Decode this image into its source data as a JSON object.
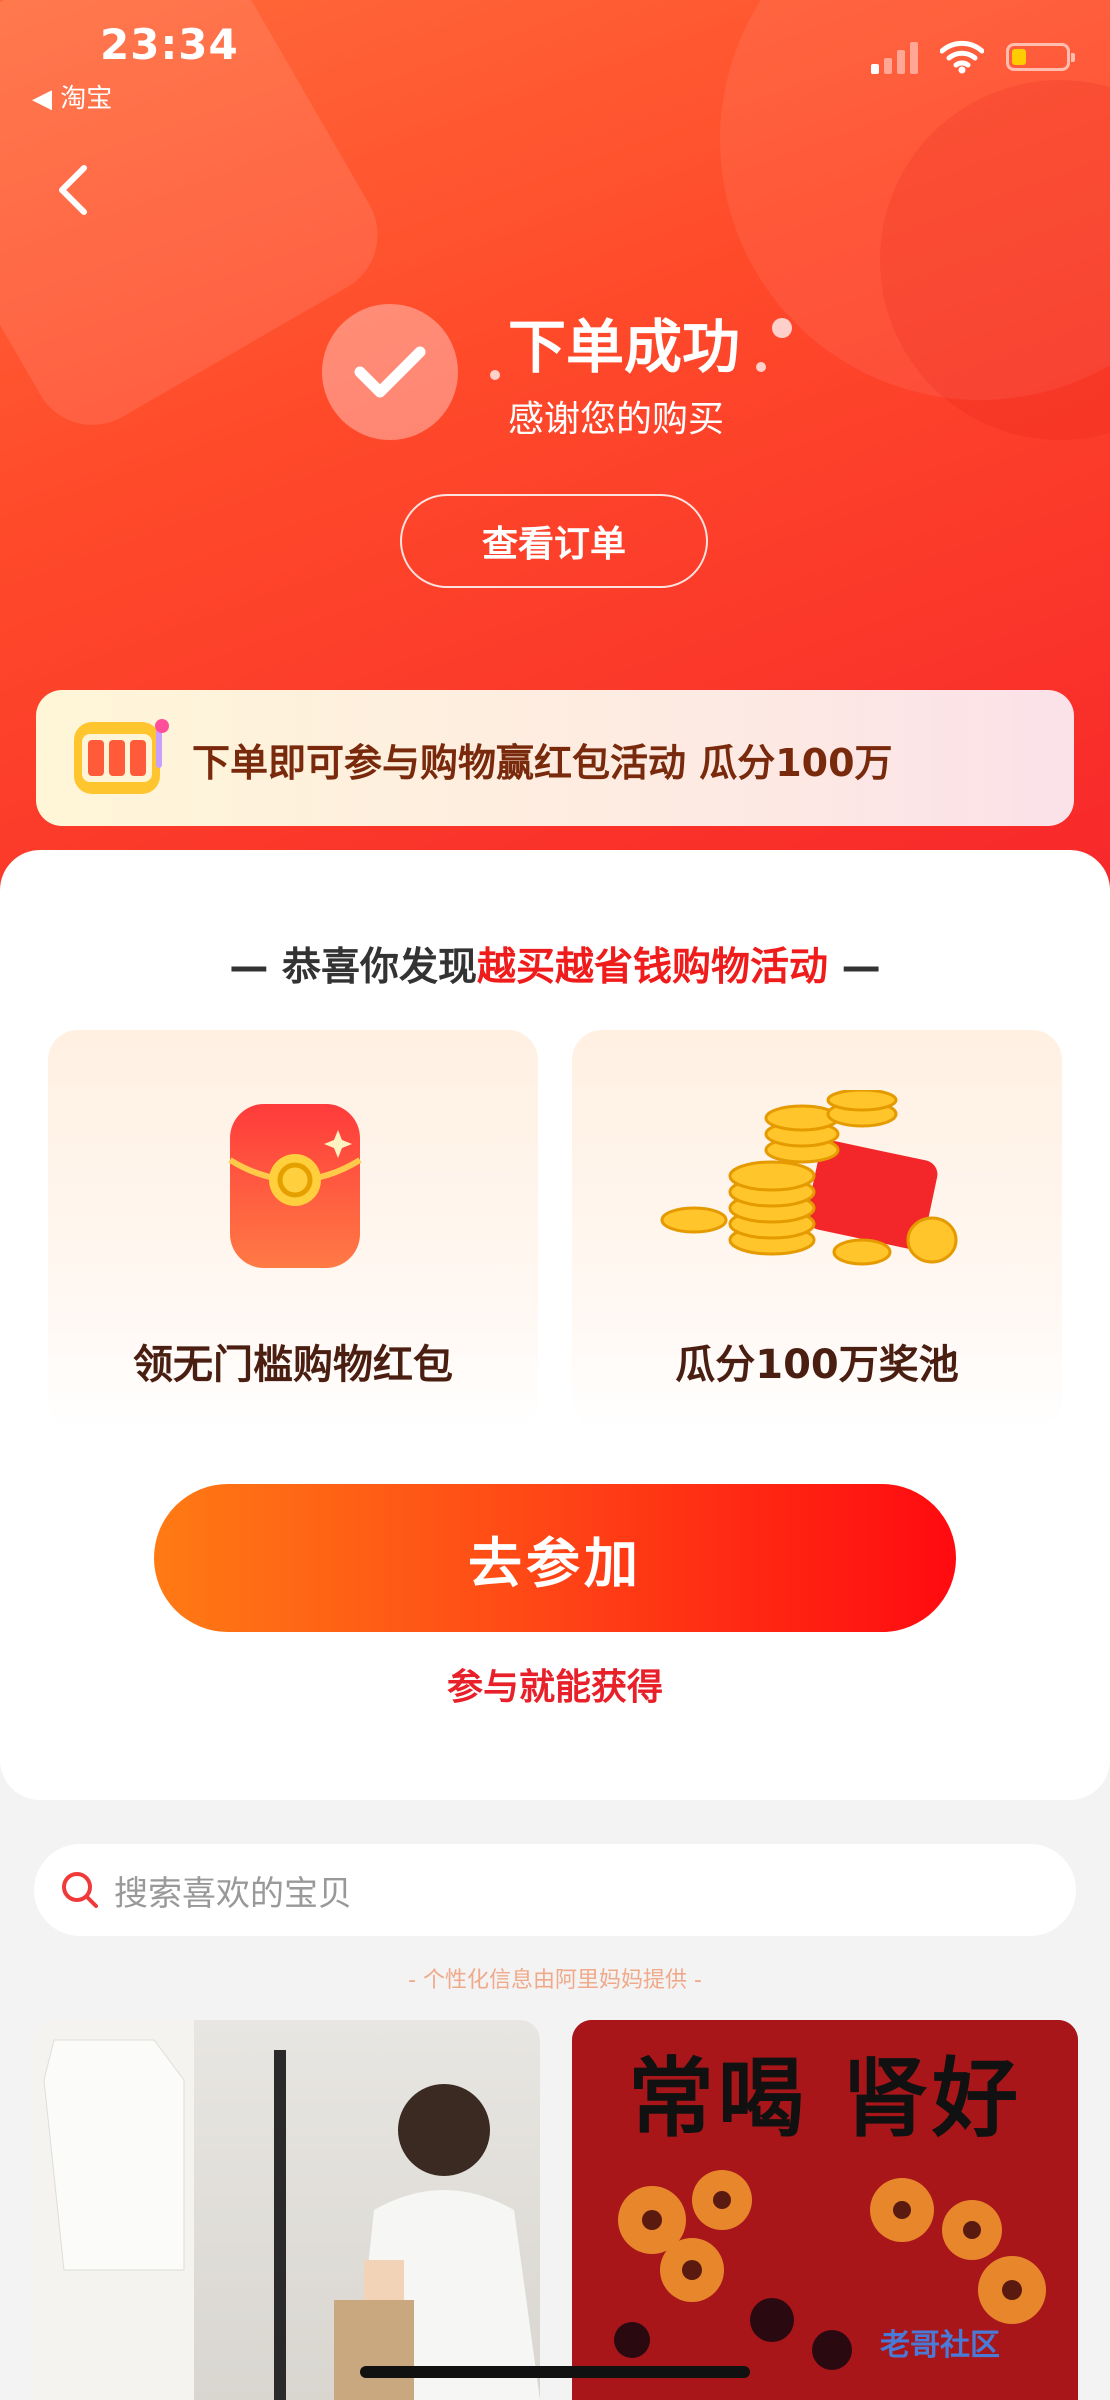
{
  "status_bar": {
    "time": "23:34",
    "back_app": "◀ 淘宝"
  },
  "header": {
    "title": "下单成功",
    "subtitle": "感谢您的购买",
    "view_order": "查看订单"
  },
  "banner": {
    "text": "下单即可参与购物赢红包活动 瓜分100万"
  },
  "promo": {
    "headline_prefix": "— 恭喜你发现",
    "headline_highlight": "越买越省钱购物活动",
    "headline_suffix": " —",
    "tiles": [
      {
        "label": "领无门槛购物红包",
        "icon": "red-envelope-icon"
      },
      {
        "label": "瓜分100万奖池",
        "icon": "gold-coins-icon"
      }
    ],
    "join_button": "去参加",
    "join_note": "参与就能获得"
  },
  "search": {
    "placeholder": "搜索喜欢的宝贝"
  },
  "provider_note": "- 个性化信息由阿里妈妈提供 -",
  "products": [
    {
      "image": "woman-wardrobe-photo"
    },
    {
      "headline": "常喝 肾好",
      "image": "dried-fruit-photo"
    }
  ],
  "watermark": "老哥社区",
  "colors": {
    "accent": "#f7262a",
    "highlight": "#f01c1c",
    "button_start": "#ff7a14"
  }
}
